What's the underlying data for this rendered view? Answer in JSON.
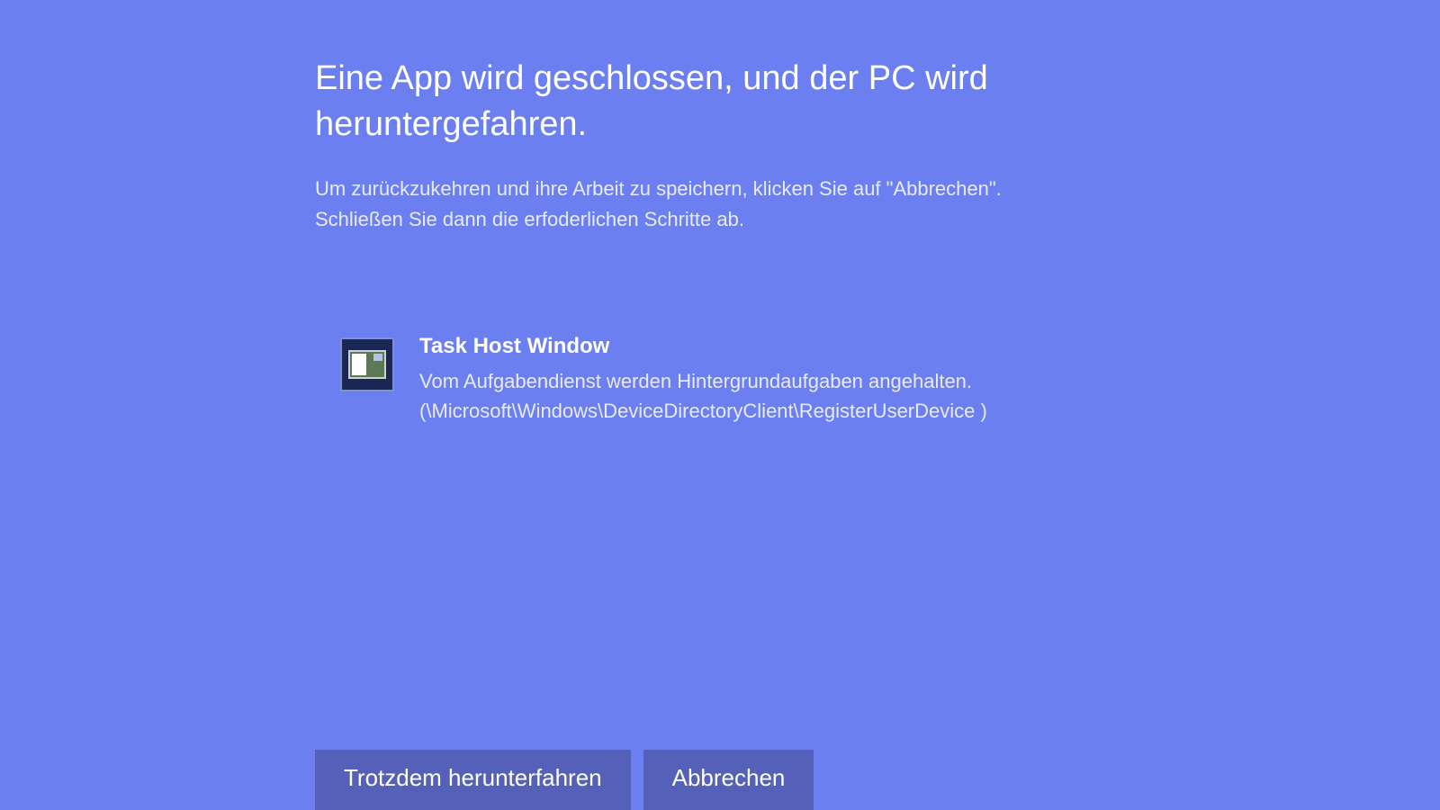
{
  "heading": "Eine App wird geschlossen, und der PC wird heruntergefahren.",
  "instruction_line1": "Um zurückzukehren und ihre Arbeit zu speichern, klicken Sie auf \"Abbrechen\".",
  "instruction_line2": "Schließen Sie dann die erfoderlichen Schritte ab.",
  "apps": [
    {
      "name": "Task Host Window",
      "description": "Vom Aufgabendienst werden Hintergrundaufgaben angehalten.",
      "path": "(\\Microsoft\\Windows\\DeviceDirectoryClient\\RegisterUserDevice )"
    }
  ],
  "buttons": {
    "force_shutdown": "Trotzdem herunterfahren",
    "cancel": "Abbrechen"
  }
}
